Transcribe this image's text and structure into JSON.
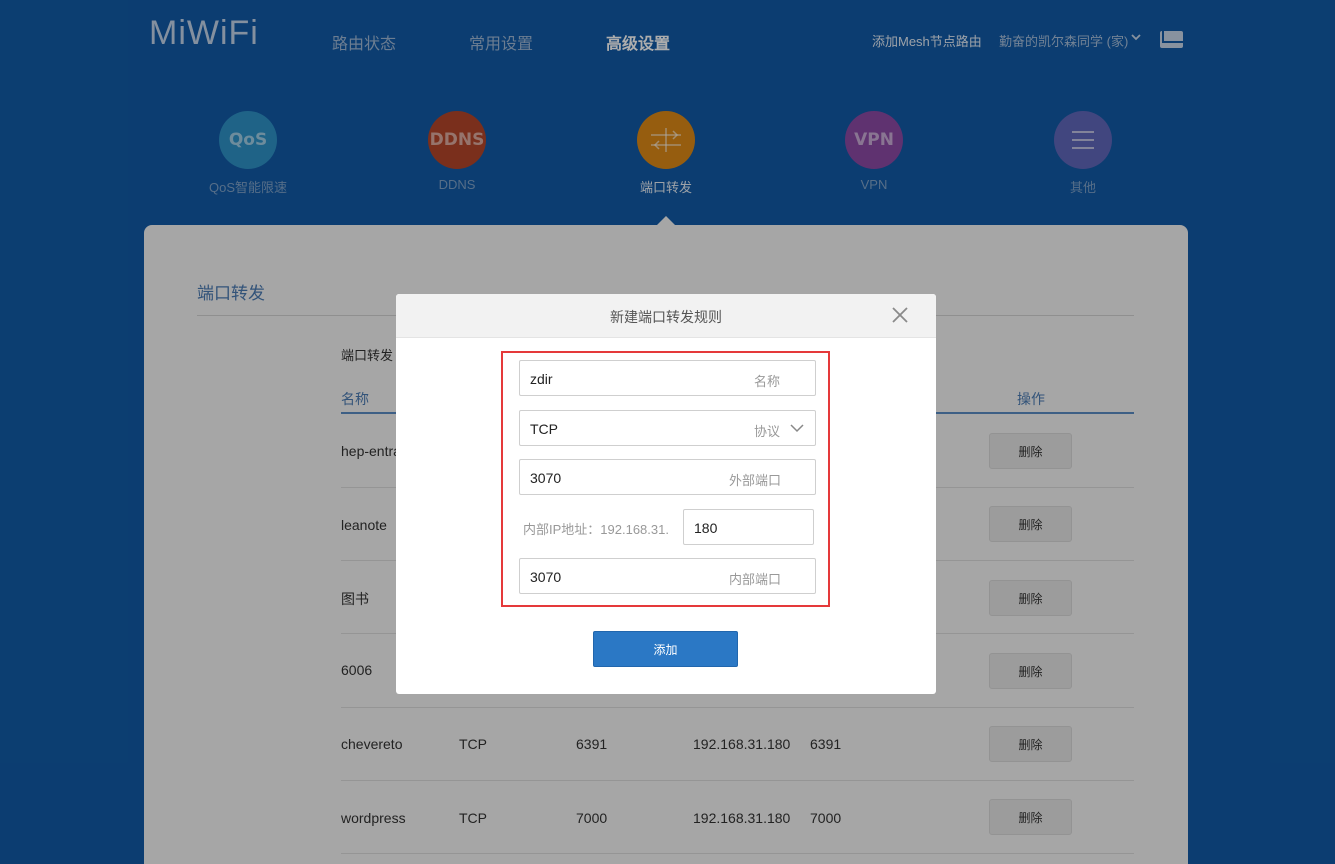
{
  "header": {
    "logo": "MiWiFi",
    "nav": [
      {
        "label": "路由状态",
        "active": false
      },
      {
        "label": "常用设置",
        "active": false
      },
      {
        "label": "高级设置",
        "active": true
      }
    ],
    "add_mesh": "添加Mesh节点路由",
    "user": "勤奋的凯尔森同学 (家)"
  },
  "features": [
    {
      "icon_text": "QoS",
      "label": "QoS智能限速",
      "color": "#2f93c8",
      "icon": "qos-icon"
    },
    {
      "icon_text": "DDNS",
      "label": "DDNS",
      "color": "#b4462a",
      "icon": "ddns-icon"
    },
    {
      "icon_text": "",
      "label": "端口转发",
      "color": "#de8a17",
      "icon": "port-forward-icon",
      "active": true
    },
    {
      "icon_text": "VPN",
      "label": "VPN",
      "color": "#8c4aa6",
      "icon": "vpn-icon"
    },
    {
      "icon_text": "",
      "label": "其他",
      "color": "#6167bb",
      "icon": "menu-icon"
    }
  ],
  "panel": {
    "title": "端口转发",
    "sub_label": "端口转发",
    "col_name": "名称",
    "col_action": "操作",
    "delete_label": "删除",
    "rows": [
      {
        "name": "hep-entra",
        "protocol": "",
        "ext_port": "",
        "ip": "",
        "int_port": ""
      },
      {
        "name": "leanote",
        "protocol": "",
        "ext_port": "",
        "ip": "",
        "int_port": ""
      },
      {
        "name": "图书",
        "protocol": "",
        "ext_port": "",
        "ip": "",
        "int_port": ""
      },
      {
        "name": "6006",
        "protocol": "",
        "ext_port": "",
        "ip": "",
        "int_port": ""
      },
      {
        "name": "chevereto",
        "protocol": "TCP",
        "ext_port": "6391",
        "ip": "192.168.31.180",
        "int_port": "6391"
      },
      {
        "name": "wordpress",
        "protocol": "TCP",
        "ext_port": "7000",
        "ip": "192.168.31.180",
        "int_port": "7000"
      }
    ]
  },
  "modal": {
    "title": "新建端口转发规则",
    "name_value": "zdir",
    "name_hint": "名称",
    "protocol_value": "TCP",
    "protocol_hint": "协议",
    "ext_port_value": "3070",
    "ext_port_hint": "外部端口",
    "ip_label": "内部IP地址：192.168.31.",
    "ip_suffix": "180",
    "int_port_value": "3070",
    "int_port_hint": "内部端口",
    "add_label": "添加"
  },
  "colors": {
    "background": "#125ba7",
    "highlight_box": "#e5393a",
    "primary_button": "#2b78c5"
  }
}
